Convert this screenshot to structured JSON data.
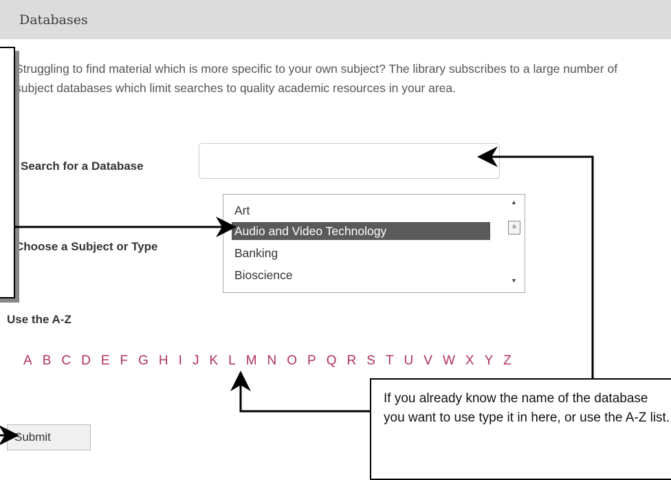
{
  "header": {
    "title": "Databases"
  },
  "intro": "Struggling to find material which is more specific to your own subject? The library subscribes to a large number of subject databases which limit searches to quality academic resources in your area.",
  "search": {
    "label": "Search for a Database",
    "value": "",
    "placeholder": ""
  },
  "subject": {
    "label": "Choose a Subject or Type",
    "options": [
      "Art",
      "Audio and Video Technology",
      "Banking",
      "Bioscience"
    ],
    "selected": "Audio and Video Technology"
  },
  "az": {
    "label": "Use the A-Z",
    "letters": [
      "A",
      "B",
      "C",
      "D",
      "E",
      "F",
      "G",
      "H",
      "I",
      "J",
      "K",
      "L",
      "M",
      "N",
      "O",
      "P",
      "Q",
      "R",
      "S",
      "T",
      "U",
      "V",
      "W",
      "X",
      "Y",
      "Z"
    ]
  },
  "submit_label": "Submit",
  "callout": {
    "text": "If you already know the name of the database you want to use type it in here, or use the A-Z list."
  },
  "colors": {
    "link": "#b03060",
    "header_bg": "#dcdcdc",
    "selected_bg": "#5a5a5a"
  }
}
